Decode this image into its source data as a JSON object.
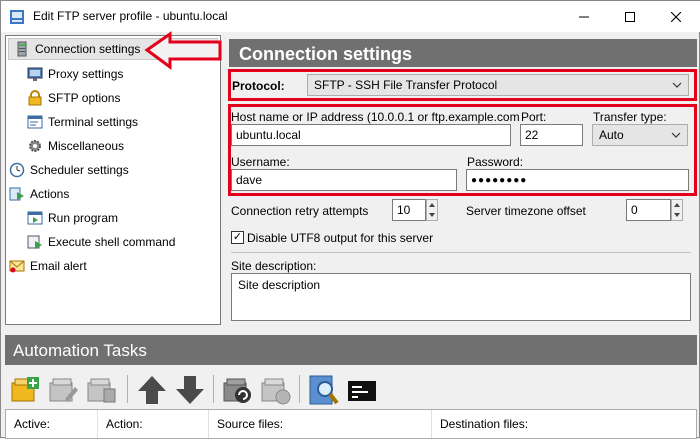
{
  "window": {
    "title": "Edit FTP server profile - ubuntu.local"
  },
  "tree": {
    "items": [
      {
        "label": "Connection settings",
        "icon": "server-icon"
      },
      {
        "label": "Proxy settings",
        "icon": "monitor-icon"
      },
      {
        "label": "SFTP options",
        "icon": "lock-icon"
      },
      {
        "label": "Terminal settings",
        "icon": "terminal-window-icon"
      },
      {
        "label": "Miscellaneous",
        "icon": "gear-icon"
      },
      {
        "label": "Scheduler settings",
        "icon": "clock-icon"
      },
      {
        "label": "Actions",
        "icon": "actions-icon"
      },
      {
        "label": "Run program",
        "icon": "run-program-icon"
      },
      {
        "label": "Execute shell command",
        "icon": "shell-command-icon"
      },
      {
        "label": "Email alert",
        "icon": "email-icon"
      }
    ]
  },
  "panel": {
    "header": "Connection settings",
    "protocol_label": "Protocol:",
    "protocol_value": "SFTP - SSH File Transfer Protocol",
    "host_label": "Host name or IP address (10.0.0.1 or ftp.example.com",
    "host_value": "ubuntu.local",
    "port_label": "Port:",
    "port_value": "22",
    "transfer_label": "Transfer type:",
    "transfer_value": "Auto",
    "username_label": "Username:",
    "username_value": "dave",
    "password_label": "Password:",
    "password_value": "●●●●●●●●",
    "retry_label": "Connection retry attempts",
    "retry_value": "10",
    "timezone_label": "Server timezone offset",
    "timezone_value": "0",
    "utf8_label": "Disable UTF8 output for this server",
    "utf8_checked": "✓",
    "site_label": "Site description:",
    "site_value": "Site description"
  },
  "tasks": {
    "header": "Automation Tasks",
    "columns": [
      "Active:",
      "Action:",
      "Source files:",
      "Destination files:"
    ]
  },
  "colors": {
    "highlight_red": "#e2001a",
    "header_gray": "#707070"
  }
}
